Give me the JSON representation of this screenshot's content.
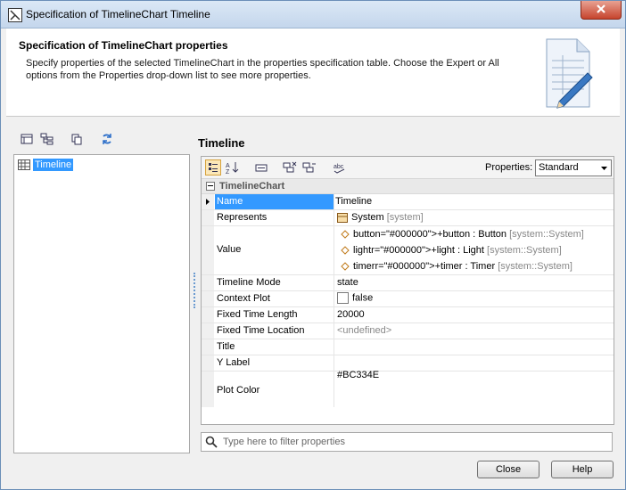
{
  "window": {
    "title": "Specification of TimelineChart Timeline"
  },
  "header": {
    "title": "Specification of TimelineChart properties",
    "description": "Specify properties of the selected TimelineChart in the properties specification table. Choose the Expert or All options from the Properties drop-down list to see more properties."
  },
  "tree": {
    "items": [
      {
        "label": "Timeline"
      }
    ]
  },
  "panel": {
    "title": "Timeline",
    "properties_label": "Properties:",
    "properties_mode": "Standard",
    "group": "TimelineChart",
    "rows": {
      "name": {
        "label": "Name",
        "value": "Timeline"
      },
      "represents": {
        "label": "Represents",
        "value": "System",
        "qualifier": "[system]"
      },
      "value": {
        "label": "Value",
        "items": [
          {
            "text": "button=\"#000000\">+button : Button",
            "qualifier": "[system::System]"
          },
          {
            "text": "lightr=\"#000000\">+light : Light",
            "qualifier": "[system::System]"
          },
          {
            "text": "timerr=\"#000000\">+timer : Timer",
            "qualifier": "[system::System]"
          }
        ]
      },
      "timeline_mode": {
        "label": "Timeline Mode",
        "value": "state"
      },
      "context_plot": {
        "label": "Context Plot",
        "value": "false"
      },
      "fixed_time_length": {
        "label": "Fixed Time Length",
        "value": "20000"
      },
      "fixed_time_location": {
        "label": "Fixed Time Location",
        "value": "<undefined>"
      },
      "title": {
        "label": "Title",
        "value": ""
      },
      "y_label": {
        "label": "Y Label",
        "value": ""
      },
      "plot_color": {
        "label": "Plot Color",
        "value": "#BC334E"
      }
    }
  },
  "filter": {
    "placeholder": "Type here to filter properties"
  },
  "buttons": {
    "close": "Close",
    "help": "Help"
  },
  "colors": {
    "selection": "#3399ff",
    "accent": "#d6a23c"
  }
}
